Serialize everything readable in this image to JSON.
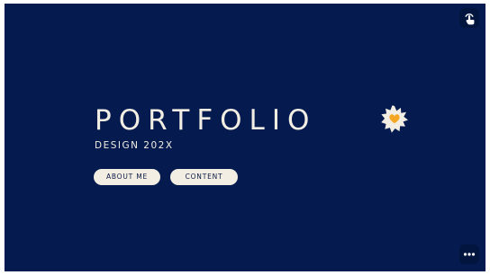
{
  "slide": {
    "title": "PORTFOLIO",
    "subtitle": "DESIGN 202X",
    "buttons": {
      "about_label": "ABOUT ME",
      "content_label": "CONTENT"
    }
  },
  "controls": {
    "top_right_icon": "tap-hand-icon",
    "bottom_right_icon": "more-options-icon"
  },
  "colors": {
    "background": "#051a4e",
    "text": "#f2eee3",
    "badge": "#f2eee3",
    "heart": "#f5a623",
    "button_text": "#0b1a44"
  }
}
